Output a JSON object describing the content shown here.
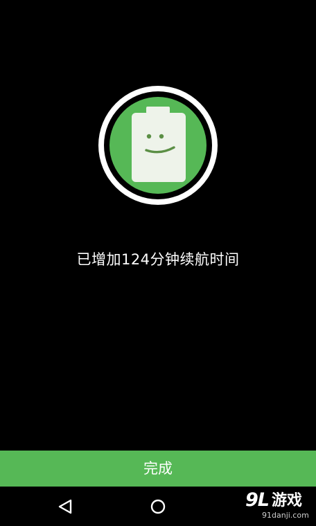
{
  "message": {
    "text": "已增加124分钟续航时间"
  },
  "action": {
    "done_label": "完成"
  },
  "icons": {
    "battery": "smiling-battery-icon",
    "back": "back-triangle-icon",
    "home": "home-circle-icon"
  },
  "watermark": {
    "logo": "9L",
    "title": "游戏",
    "url": "91danji.com"
  },
  "colors": {
    "background": "#000000",
    "accent_green": "#56b856",
    "battery_body": "#eef3ea",
    "ring": "#ffffff",
    "text": "#ffffff"
  }
}
